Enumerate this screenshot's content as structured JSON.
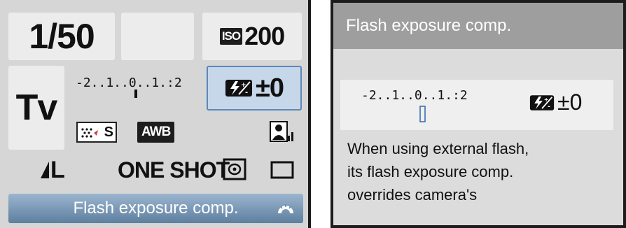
{
  "quick_control": {
    "shutter_speed": "1/50",
    "iso_badge": "ISO",
    "iso_value": "200",
    "shooting_mode": "Tv",
    "exposure_scale": "-2..1..0..1.:2",
    "flash_exposure_comp": "±0",
    "picture_style_label": "S",
    "white_balance": "AWB",
    "image_quality": "L",
    "af_mode": "ONE SHOT",
    "status_label": "Flash exposure comp.",
    "icons": [
      "flash-exposure-comp-icon",
      "picture-style-icon",
      "auto-lighting-optimizer-icon",
      "metering-mode-icon",
      "drive-mode-icon",
      "main-dial-icon"
    ]
  },
  "help_screen": {
    "title": "Flash exposure comp.",
    "exposure_scale": "-2..1..0..1.:2",
    "flash_exposure_comp": "±0",
    "description_lines": [
      "When using external flash,",
      "its flash exposure comp.",
      "overrides camera's"
    ]
  }
}
